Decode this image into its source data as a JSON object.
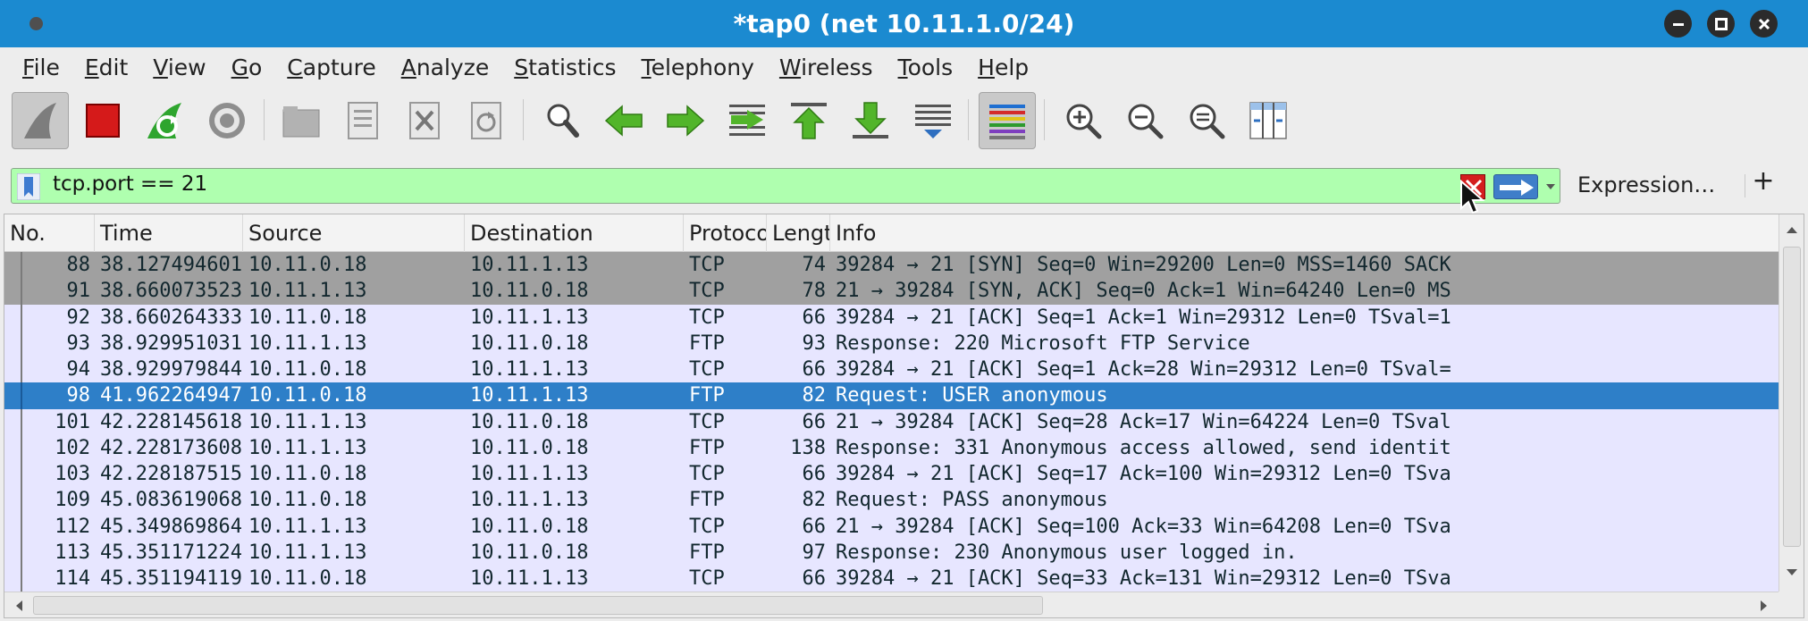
{
  "window": {
    "title": "*tap0 (net 10.11.1.0/24)"
  },
  "menu": [
    "File",
    "Edit",
    "View",
    "Go",
    "Capture",
    "Analyze",
    "Statistics",
    "Telephony",
    "Wireless",
    "Tools",
    "Help"
  ],
  "toolbar": {
    "buttons": [
      {
        "name": "start-capture-icon",
        "pressed": true
      },
      {
        "name": "stop-capture-icon"
      },
      {
        "name": "restart-capture-icon"
      },
      {
        "name": "capture-options-icon"
      },
      {
        "name": "open-file-icon"
      },
      {
        "name": "save-file-icon"
      },
      {
        "name": "close-file-icon"
      },
      {
        "name": "reload-file-icon"
      },
      {
        "name": "find-packet-icon"
      },
      {
        "name": "go-back-icon"
      },
      {
        "name": "go-forward-icon"
      },
      {
        "name": "go-to-packet-icon"
      },
      {
        "name": "go-first-packet-icon"
      },
      {
        "name": "go-last-packet-icon"
      },
      {
        "name": "autoscroll-icon"
      },
      {
        "name": "colorize-icon",
        "pressed": true
      },
      {
        "name": "zoom-in-icon"
      },
      {
        "name": "zoom-out-icon"
      },
      {
        "name": "normal-size-icon"
      },
      {
        "name": "resize-columns-icon"
      }
    ]
  },
  "filter": {
    "value": "tcp.port == 21",
    "expression_label": "Expression…",
    "add_label": "+",
    "bg_color": "#afffaf"
  },
  "packet_list": {
    "columns": [
      "No.",
      "Time",
      "Source",
      "Destination",
      "Protocol",
      "Length",
      "Info"
    ],
    "selected_row": 5,
    "colors": {
      "syn_bg": "#a0a0a0",
      "normal_bg": "#e7e6ff",
      "selected_bg": "#2e7fc8",
      "selected_fg": "#ffffff",
      "text": "#12272e"
    },
    "rows": [
      {
        "no": "88",
        "time": "38.127494601",
        "source": "10.11.0.18",
        "destination": "10.11.1.13",
        "protocol": "TCP",
        "length": "74",
        "info": "39284 → 21 [SYN] Seq=0 Win=29200 Len=0 MSS=1460 SACK",
        "style": "syn"
      },
      {
        "no": "91",
        "time": "38.660073523",
        "source": "10.11.1.13",
        "destination": "10.11.0.18",
        "protocol": "TCP",
        "length": "78",
        "info": "21 → 39284 [SYN, ACK] Seq=0 Ack=1 Win=64240 Len=0 MS",
        "style": "syn"
      },
      {
        "no": "92",
        "time": "38.660264333",
        "source": "10.11.0.18",
        "destination": "10.11.1.13",
        "protocol": "TCP",
        "length": "66",
        "info": "39284 → 21 [ACK] Seq=1 Ack=1 Win=29312 Len=0 TSval=1",
        "style": "normal"
      },
      {
        "no": "93",
        "time": "38.929951031",
        "source": "10.11.1.13",
        "destination": "10.11.0.18",
        "protocol": "FTP",
        "length": "93",
        "info": "Response: 220 Microsoft FTP Service",
        "style": "normal"
      },
      {
        "no": "94",
        "time": "38.929979844",
        "source": "10.11.0.18",
        "destination": "10.11.1.13",
        "protocol": "TCP",
        "length": "66",
        "info": "39284 → 21 [ACK] Seq=1 Ack=28 Win=29312 Len=0 TSval=",
        "style": "normal"
      },
      {
        "no": "98",
        "time": "41.962264947",
        "source": "10.11.0.18",
        "destination": "10.11.1.13",
        "protocol": "FTP",
        "length": "82",
        "info": "Request: USER anonymous",
        "style": "selected"
      },
      {
        "no": "101",
        "time": "42.228145618",
        "source": "10.11.1.13",
        "destination": "10.11.0.18",
        "protocol": "TCP",
        "length": "66",
        "info": "21 → 39284 [ACK] Seq=28 Ack=17 Win=64224 Len=0 TSval",
        "style": "normal"
      },
      {
        "no": "102",
        "time": "42.228173608",
        "source": "10.11.1.13",
        "destination": "10.11.0.18",
        "protocol": "FTP",
        "length": "138",
        "info": "Response: 331 Anonymous access allowed, send identit",
        "style": "normal"
      },
      {
        "no": "103",
        "time": "42.228187515",
        "source": "10.11.0.18",
        "destination": "10.11.1.13",
        "protocol": "TCP",
        "length": "66",
        "info": "39284 → 21 [ACK] Seq=17 Ack=100 Win=29312 Len=0 TSva",
        "style": "normal"
      },
      {
        "no": "109",
        "time": "45.083619068",
        "source": "10.11.0.18",
        "destination": "10.11.1.13",
        "protocol": "FTP",
        "length": "82",
        "info": "Request: PASS anonymous",
        "style": "normal"
      },
      {
        "no": "112",
        "time": "45.349869864",
        "source": "10.11.1.13",
        "destination": "10.11.0.18",
        "protocol": "TCP",
        "length": "66",
        "info": "21 → 39284 [ACK] Seq=100 Ack=33 Win=64208 Len=0 TSva",
        "style": "normal"
      },
      {
        "no": "113",
        "time": "45.351171224",
        "source": "10.11.1.13",
        "destination": "10.11.0.18",
        "protocol": "FTP",
        "length": "97",
        "info": "Response: 230 Anonymous user logged in.",
        "style": "normal"
      },
      {
        "no": "114",
        "time": "45.351194119",
        "source": "10.11.0.18",
        "destination": "10.11.1.13",
        "protocol": "TCP",
        "length": "66",
        "info": "39284 → 21 [ACK] Seq=33 Ack=131 Win=29312 Len=0 TSva",
        "style": "normal"
      }
    ]
  }
}
